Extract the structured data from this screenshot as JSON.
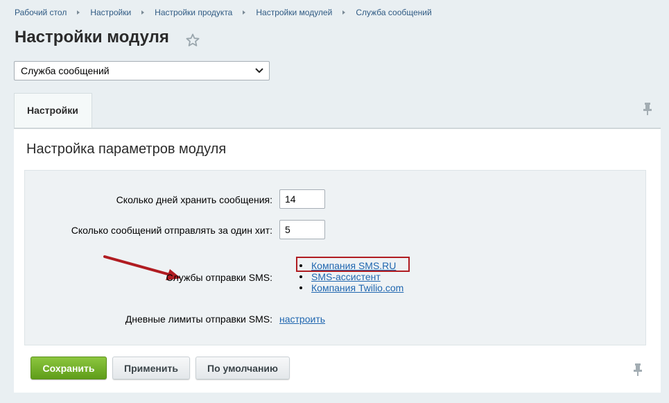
{
  "breadcrumb": [
    "Рабочий стол",
    "Настройки",
    "Настройки продукта",
    "Настройки модулей",
    "Служба сообщений"
  ],
  "page_title": "Настройки модуля",
  "module_select": {
    "value": "Служба сообщений"
  },
  "tabs": [
    {
      "label": "Настройки"
    }
  ],
  "section_title": "Настройка параметров модуля",
  "fields": {
    "keep_days": {
      "label": "Сколько дней хранить сообщения:",
      "value": "14"
    },
    "per_hit": {
      "label": "Сколько сообщений отправлять за один хит:",
      "value": "5"
    },
    "sms_services": {
      "label": "Службы отправки SMS:",
      "items": [
        "Компания SMS.RU",
        "SMS-ассистент",
        "Компания Twilio.com"
      ]
    },
    "daily_limits": {
      "label": "Дневные лимиты отправки SMS:",
      "link": "настроить"
    }
  },
  "buttons": {
    "save": "Сохранить",
    "apply": "Применить",
    "default": "По умолчанию"
  },
  "colors": {
    "highlight": "#b01c21",
    "save_button": "#6fae24",
    "link": "#2067b0"
  },
  "icons": [
    "star-icon",
    "chevron-down-icon",
    "pin-icon",
    "arrow-annotation"
  ]
}
